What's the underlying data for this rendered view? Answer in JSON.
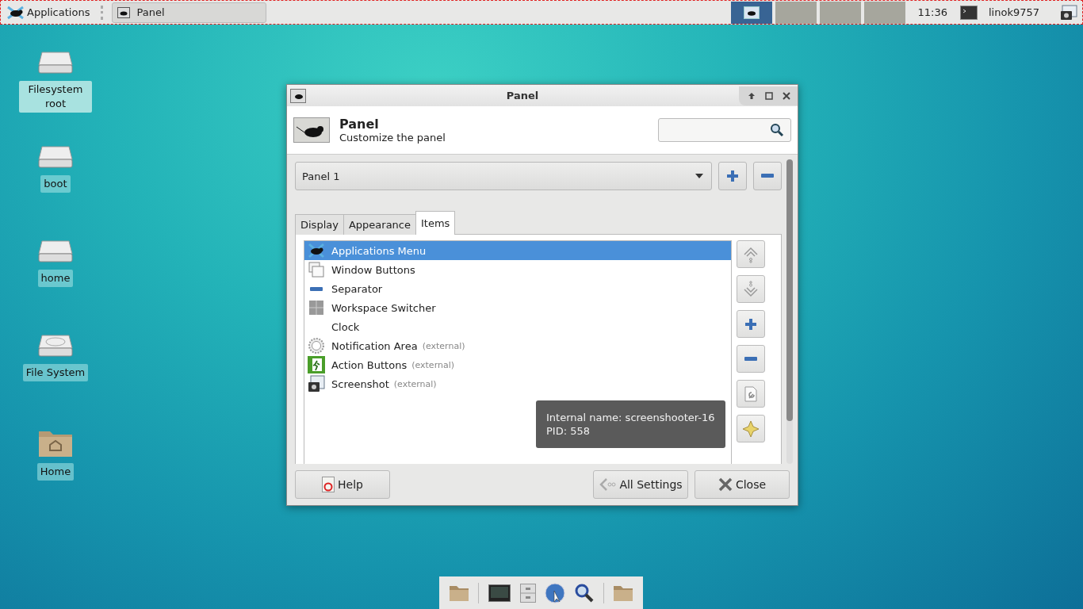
{
  "top_panel": {
    "menu_label": "Applications",
    "tasks": [
      {
        "label": "Panel",
        "selected": true
      }
    ],
    "workspaces": [
      {
        "selected": true
      },
      {
        "selected": false
      },
      {
        "selected": false
      },
      {
        "selected": false
      }
    ],
    "clock": "11:36",
    "user": "linok9757"
  },
  "desktop_icons": [
    {
      "label": "Filesystem root",
      "kind": "drive",
      "selected": true
    },
    {
      "label": "boot",
      "kind": "drive",
      "selected": false
    },
    {
      "label": "home",
      "kind": "drive",
      "selected": false
    },
    {
      "label": "File System",
      "kind": "disk",
      "selected": false
    },
    {
      "label": "Home",
      "kind": "folder",
      "selected": false
    }
  ],
  "window": {
    "title": "Panel",
    "header_title": "Panel",
    "header_subtitle": "Customize the panel",
    "panel_select": "Panel 1",
    "tabs": [
      {
        "label": "Display",
        "selected": false
      },
      {
        "label": "Appearance",
        "selected": false
      },
      {
        "label": "Items",
        "selected": true
      }
    ],
    "items": [
      {
        "name": "Applications Menu",
        "kind": "mouse",
        "selected": true
      },
      {
        "name": "Window Buttons",
        "kind": "windows",
        "selected": false
      },
      {
        "name": "Separator",
        "kind": "separator",
        "selected": false
      },
      {
        "name": "Workspace Switcher",
        "kind": "grid",
        "selected": false
      },
      {
        "name": "Clock",
        "kind": "none",
        "selected": false
      },
      {
        "name": "Notification Area",
        "note": "(external)",
        "kind": "gear",
        "selected": false
      },
      {
        "name": "Action Buttons",
        "note": "(external)",
        "kind": "exit",
        "selected": false
      },
      {
        "name": "Screenshot",
        "note": "(external)",
        "kind": "camera",
        "selected": false
      }
    ],
    "tooltip": [
      "Internal name: screenshooter-16",
      "PID: 558"
    ],
    "buttons": {
      "help": "Help",
      "all_settings": "All Settings",
      "close": "Close"
    }
  }
}
